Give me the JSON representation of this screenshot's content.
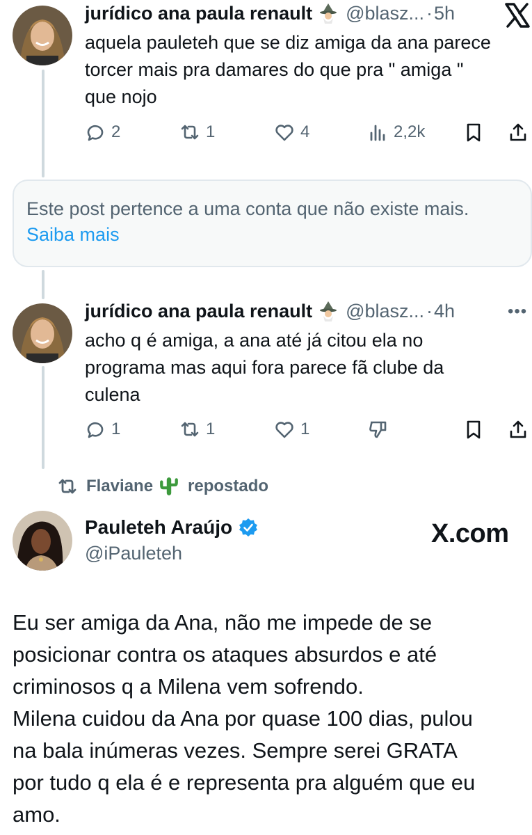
{
  "tweets": [
    {
      "name": "jurídico ana paula renault",
      "handle": "@blasz...",
      "time": "5h",
      "text_lines": [
        "aquela pauleteh que se diz amiga da ana parece",
        "torcer mais pra damares do que pra \" amiga \"",
        "que nojo"
      ],
      "replies": "2",
      "reposts": "1",
      "likes": "4",
      "views": "2,2k"
    },
    {
      "name": "jurídico ana paula renault",
      "handle": "@blasz...",
      "time": "4h",
      "text_lines": [
        "acho q é amiga, a ana até já citou ela no",
        "programa mas aqui fora parece fã clube da",
        "culena"
      ],
      "replies": "1",
      "reposts": "1",
      "likes": "1"
    }
  ],
  "notice": {
    "message": "Este post pertence a uma conta que não existe mais.",
    "link": "Saiba mais"
  },
  "repost_bar": {
    "user": "Flaviane",
    "label": "repostado"
  },
  "quoted": {
    "name": "Pauleteh Araújo",
    "handle": "@iPauleteh",
    "watermark": "X.com",
    "text_lines": [
      "Eu ser amiga da Ana, não me impede de se",
      "posicionar contra os ataques absurdos e até",
      "criminosos q a Milena vem sofrendo.",
      "Milena cuidou da Ana por quase 100 dias, pulou",
      "na bala inúmeras vezes. Sempre serei GRATA",
      "por tudo q ela é e representa pra alguém que eu",
      "amo."
    ]
  },
  "icons": [
    "reply-icon",
    "repost-icon",
    "like-icon",
    "views-icon",
    "bookmark-icon",
    "share-icon",
    "dislike-icon",
    "x-logo-icon",
    "more-icon",
    "verified-icon",
    "wizard-emoji",
    "cactus-emoji"
  ],
  "colors": {
    "text": "#0f1419",
    "secondary": "#536471",
    "link": "#1d9bf0",
    "verified": "#1d9bf0",
    "thread_line": "#cfd9de",
    "notice_bg": "#f7f9f9"
  }
}
